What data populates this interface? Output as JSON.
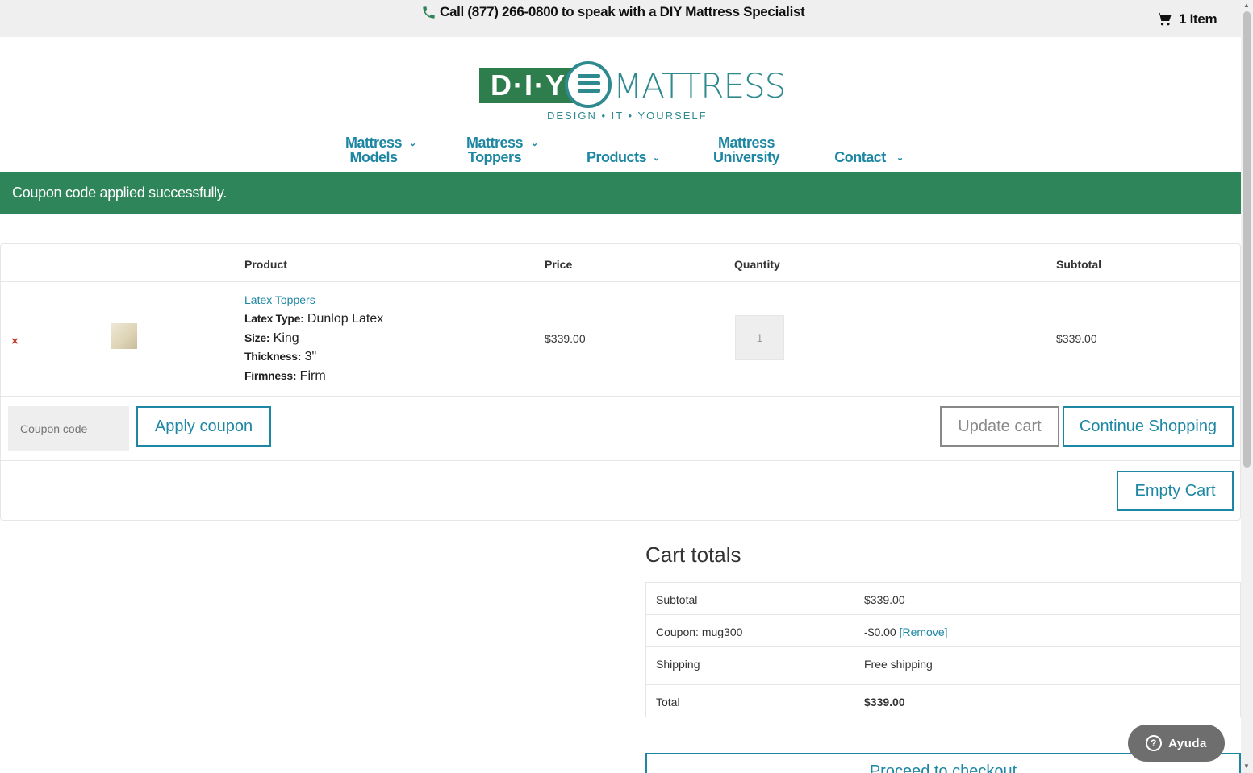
{
  "topbar": {
    "phone_text": "Call (877) 266-0800 to speak with a DIY Mattress Specialist",
    "cart_text": "1 Item",
    "icons": [
      "phone-icon",
      "cart-icon"
    ]
  },
  "logo": {
    "left_text": "D·I·Y",
    "right_text": "MATTRESS",
    "tagline": "DESIGN • IT • YOURSELF"
  },
  "nav": {
    "items": [
      {
        "line1": "Mattress",
        "line2": "Models",
        "has_dropdown": true
      },
      {
        "line1": "Mattress",
        "line2": "Toppers",
        "has_dropdown": true
      },
      {
        "line1": "",
        "line2": "Products",
        "has_dropdown": true
      },
      {
        "line1": "Mattress",
        "line2": "University",
        "has_dropdown": false
      },
      {
        "line1": "",
        "line2": "Contact",
        "has_dropdown": true
      }
    ],
    "chevron": "⌄"
  },
  "notice": {
    "message": "Coupon code applied successfully."
  },
  "cart": {
    "headers": {
      "product": "Product",
      "price": "Price",
      "quantity": "Quantity",
      "subtotal": "Subtotal"
    },
    "item": {
      "remove": "×",
      "name": "Latex Toppers",
      "meta": [
        {
          "label": "Latex Type:",
          "value": "Dunlop Latex"
        },
        {
          "label": "Size:",
          "value": "King"
        },
        {
          "label": "Thickness:",
          "value": "3\""
        },
        {
          "label": "Firmness:",
          "value": "Firm"
        }
      ],
      "price": "$339.00",
      "quantity": "1",
      "subtotal": "$339.00"
    },
    "coupon_placeholder": "Coupon code",
    "apply_coupon": "Apply coupon",
    "update_cart": "Update cart",
    "continue_shopping": "Continue Shopping",
    "empty_cart": "Empty Cart"
  },
  "totals": {
    "title": "Cart totals",
    "rows": [
      {
        "label": "Subtotal",
        "value": "$339.00"
      },
      {
        "label": "Coupon: mug300",
        "value": "-$0.00",
        "link": "[Remove]"
      },
      {
        "label": "Shipping",
        "value": "Free shipping"
      },
      {
        "label": "Total",
        "value": "$339.00"
      }
    ],
    "checkout": "Proceed to checkout"
  },
  "help": {
    "label": "Ayuda",
    "icon": "?"
  },
  "colors": {
    "brand_teal": "#1d87a3",
    "notice_green": "#2e8559",
    "logo_green": "#2e7d4c"
  }
}
